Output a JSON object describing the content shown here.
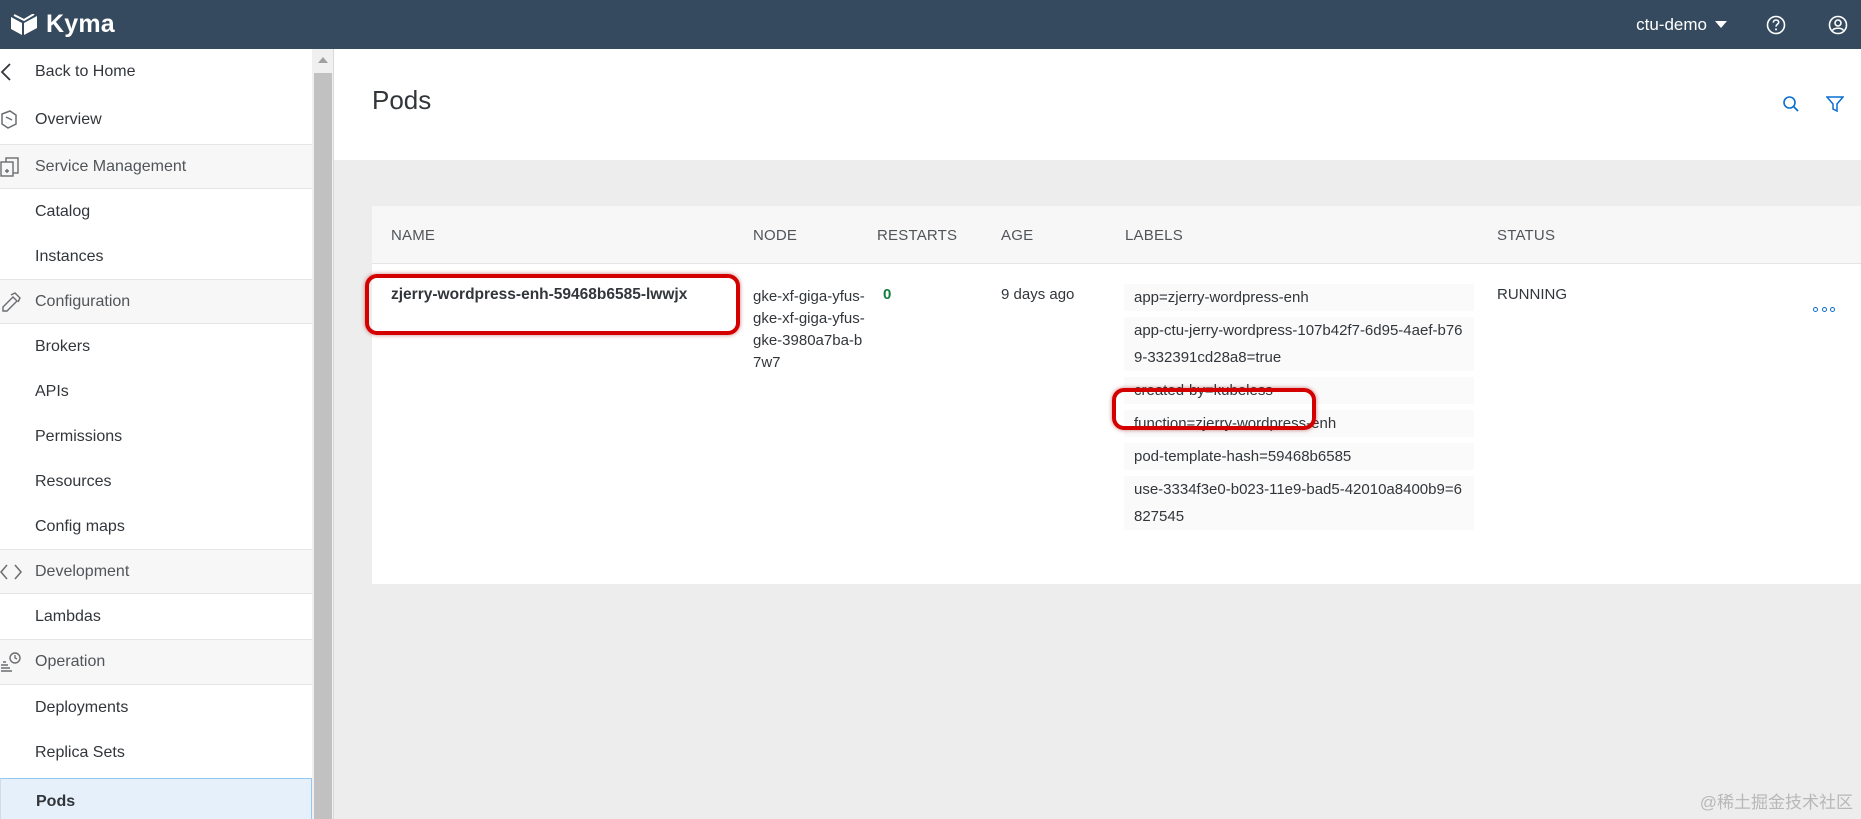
{
  "shellbar": {
    "brand": "Kyma",
    "namespace": "ctu-demo"
  },
  "sidebar": {
    "back": "Back to Home",
    "overview": "Overview",
    "sections": {
      "service_management": "Service Management",
      "configuration": "Configuration",
      "development": "Development",
      "operation": "Operation"
    },
    "items": {
      "catalog": "Catalog",
      "instances": "Instances",
      "brokers": "Brokers",
      "apis": "APIs",
      "permissions": "Permissions",
      "resources": "Resources",
      "config_maps": "Config maps",
      "lambdas": "Lambdas",
      "deployments": "Deployments",
      "replica_sets": "Replica Sets",
      "pods": "Pods"
    }
  },
  "page": {
    "title": "Pods"
  },
  "table": {
    "headers": {
      "name": "NAME",
      "node": "NODE",
      "restarts": "RESTARTS",
      "age": "AGE",
      "labels": "LABELS",
      "status": "STATUS"
    },
    "row": {
      "name": "zjerry-wordpress-enh-59468b6585-lwwjx",
      "node": "gke-xf-giga-yfus-gke-xf-giga-yfus-gke-3980a7ba-b7w7",
      "restarts": "0",
      "age": "9 days ago",
      "labels": [
        "app=zjerry-wordpress-enh",
        "app-ctu-jerry-wordpress-107b42f7-6d95-4aef-b769-332391cd28a8=true",
        "created-by=kubeless",
        "function=zjerry-wordpress-enh",
        "pod-template-hash=59468b6585",
        "use-3334f3e0-b023-11e9-bad5-42010a8400b9=6827545"
      ],
      "status": "RUNNING"
    }
  },
  "watermark": "@稀土掘金技术社区",
  "colors": {
    "shellbar": "#354a5f",
    "accent": "#0a6ed1",
    "restarts_green": "#107e3e",
    "highlight_red": "#d40000"
  }
}
